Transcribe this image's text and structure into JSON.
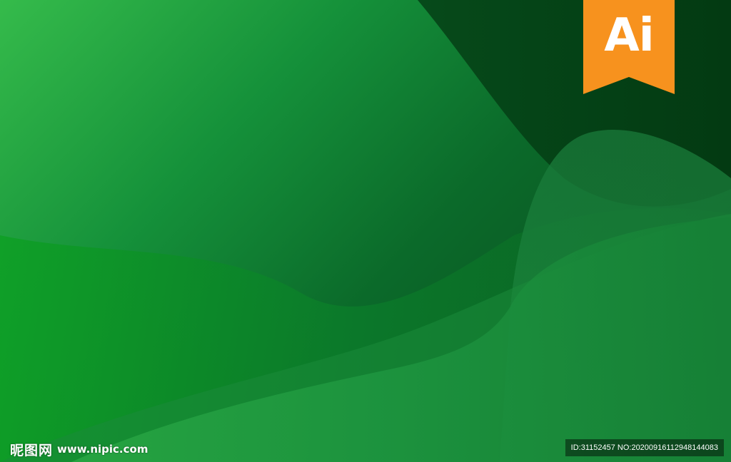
{
  "badge": {
    "text": "Ai",
    "color": "#f7921e"
  },
  "watermark": {
    "brand": "昵图网",
    "site": "www.nipic.com",
    "id_line": "ID:31152457 NO:20200916112948144083"
  },
  "colors": {
    "light_green": "#2fb848",
    "mid_green": "#128a34",
    "dark_green": "#0b4d1f",
    "darkest_green": "#063d17"
  }
}
